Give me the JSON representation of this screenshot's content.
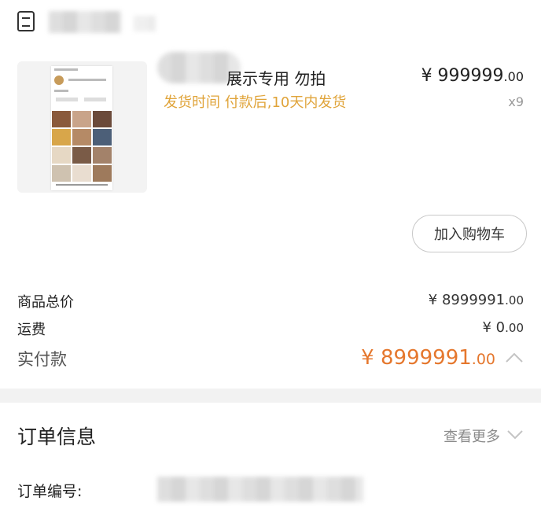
{
  "product": {
    "title_visible": "展示专用 勿拍",
    "shipping_text": "发货时间 付款后,10天内发货",
    "price_int": "¥ 999999",
    "price_dec": ".00",
    "quantity": "x9",
    "add_to_cart_label": "加入购物车"
  },
  "summary": {
    "goods_total_label": "商品总价",
    "goods_total_int": "¥ 8999991",
    "goods_total_dec": ".00",
    "shipping_label": "运费",
    "shipping_int": "¥ 0",
    "shipping_dec": ".00",
    "paid_label": "实付款",
    "paid_int": "¥ 8999991",
    "paid_dec": ".00"
  },
  "order_info": {
    "section_title": "订单信息",
    "more_label": "查看更多",
    "order_number_label": "订单编号:"
  },
  "colors": {
    "accent_orange": "#e5772d",
    "shipping_gold": "#e0a43a"
  },
  "icons": [
    "shop-icon",
    "chevron-up-icon",
    "chevron-down-icon"
  ]
}
